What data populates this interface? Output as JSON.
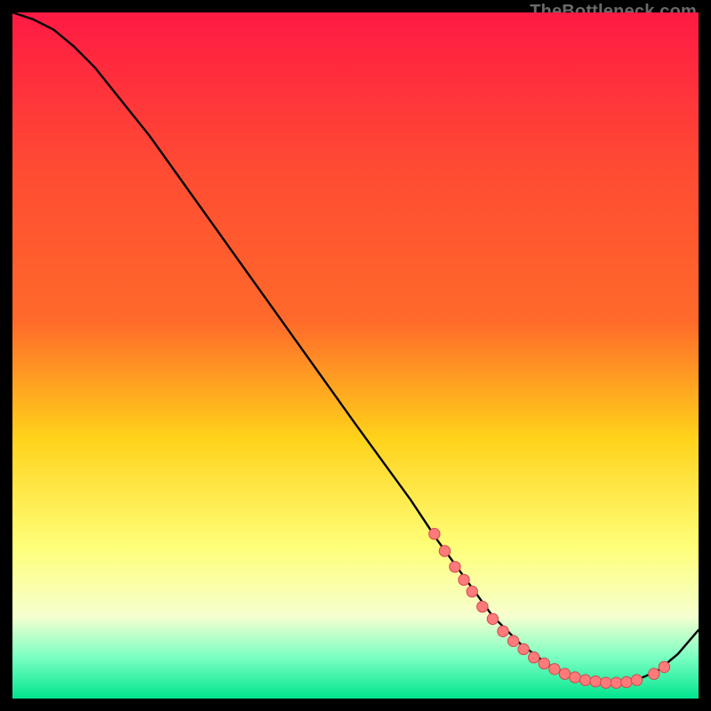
{
  "watermark": "TheBottleneck.com",
  "colors": {
    "bg": "#000000",
    "grad_top": "#ff1a44",
    "grad_mid1": "#ff6a2a",
    "grad_mid2": "#ffd21a",
    "grad_low": "#ffff7a",
    "grad_pale": "#f6ffcf",
    "grad_green1": "#7affc2",
    "grad_green2": "#00e58f",
    "curve": "#000000",
    "dot_fill": "#ff7a7a",
    "dot_stroke": "#cc4d4d"
  },
  "chart_data": {
    "type": "line",
    "title": "",
    "xlabel": "",
    "ylabel": "",
    "xlim": [
      0,
      100
    ],
    "ylim": [
      0,
      100
    ],
    "curve": {
      "x": [
        0,
        3,
        6,
        9,
        12,
        20,
        30,
        40,
        50,
        58,
        62,
        66,
        70,
        74,
        78,
        82,
        86,
        90,
        94,
        97,
        100
      ],
      "y": [
        100,
        99,
        97.5,
        95,
        92,
        82,
        68,
        54,
        40,
        29,
        23,
        17.5,
        12,
        8,
        5,
        3,
        2.3,
        2.3,
        4,
        6.5,
        10
      ]
    },
    "dots": {
      "x": [
        61.5,
        63.0,
        64.5,
        65.8,
        67.0,
        68.5,
        70.0,
        71.5,
        73.0,
        74.5,
        76.0,
        77.5,
        79.0,
        80.5,
        82.0,
        83.5,
        85.0,
        86.5,
        88.0,
        89.5,
        91.0,
        93.5,
        95.0
      ],
      "y": [
        24.0,
        21.5,
        19.2,
        17.3,
        15.6,
        13.4,
        11.6,
        9.8,
        8.4,
        7.2,
        6.0,
        5.1,
        4.3,
        3.6,
        3.1,
        2.7,
        2.5,
        2.3,
        2.3,
        2.4,
        2.7,
        3.6,
        4.6
      ]
    }
  }
}
